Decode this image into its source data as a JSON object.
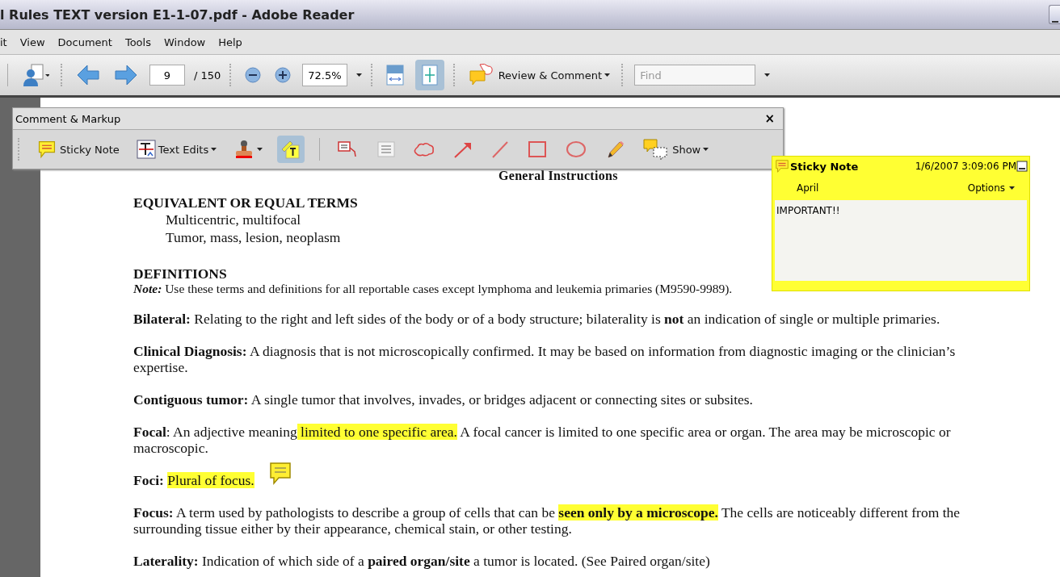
{
  "window": {
    "title": "l Rules TEXT version E1-1-07.pdf - Adobe Reader"
  },
  "menu": [
    "it",
    "View",
    "Document",
    "Tools",
    "Window",
    "Help"
  ],
  "toolbar": {
    "page": "9",
    "page_total": "/ 150",
    "zoom": "72.5%",
    "review_button": "Review & Comment",
    "find_placeholder": "Find",
    "fit_width_selected": false,
    "fit_page_selected": true
  },
  "comment_toolbar": {
    "title": "Comment & Markup",
    "close": "×",
    "tools": [
      {
        "kind": "sticky",
        "label": "Sticky Note",
        "selected": false,
        "dropdown": false
      },
      {
        "kind": "textedits",
        "label": "Text Edits",
        "selected": false,
        "dropdown": true
      },
      {
        "kind": "stamp",
        "selected": false,
        "dropdown": true
      },
      {
        "kind": "highlight",
        "selected": true,
        "dropdown": false
      },
      {
        "kind": "callout",
        "selected": false,
        "dropdown": false
      },
      {
        "kind": "textbox",
        "selected": false,
        "dropdown": false
      },
      {
        "kind": "cloud",
        "selected": false,
        "dropdown": false
      },
      {
        "kind": "arrow",
        "selected": false,
        "dropdown": false
      },
      {
        "kind": "line",
        "selected": false,
        "dropdown": false
      },
      {
        "kind": "rectangle",
        "selected": false,
        "dropdown": false
      },
      {
        "kind": "oval",
        "selected": false,
        "dropdown": false
      },
      {
        "kind": "pencil",
        "selected": false,
        "dropdown": false
      },
      {
        "kind": "show",
        "label": "Show",
        "selected": false,
        "dropdown": true
      }
    ]
  },
  "document": [
    {
      "kind": "title",
      "text": "General Instructions"
    },
    {
      "kind": "heading",
      "text": "EQUIVALENT OR EQUAL TERMS"
    },
    {
      "kind": "indent",
      "text": "Multicentric, multifocal"
    },
    {
      "kind": "indent",
      "text": "Tumor, mass, lesion, neoplasm"
    },
    {
      "kind": "heading",
      "text": "DEFINITIONS"
    },
    {
      "kind": "note",
      "label": "Note:",
      "text": " Use these terms and definitions for all reportable cases except lymphoma and leukemia primaries (M9590-9989)."
    },
    {
      "kind": "definition",
      "term": "Bilateral:",
      "segments": [
        {
          "text": " Relating to the right and left sides of the body or of a body structure; bilaterality is **not** an indication of single or multiple primaries.",
          "highlighted": false
        }
      ]
    },
    {
      "kind": "definition",
      "term": "Clinical Diagnosis:",
      "segments": [
        {
          "text": " A diagnosis that is not microscopically confirmed. It may be based on information from diagnostic imaging or the clinician’s expertise.",
          "highlighted": false
        }
      ]
    },
    {
      "kind": "definition",
      "term": "Contiguous tumor:",
      "segments": [
        {
          "text": "  A single tumor that involves, invades, or bridges adjacent or connecting sites or subsites.",
          "highlighted": false
        }
      ]
    },
    {
      "kind": "definition",
      "term": "Focal",
      "segments": [
        {
          "text": ":  An adjective meaning",
          "highlighted": false
        },
        {
          "text": " limited to one specific area.",
          "highlighted": true
        },
        {
          "text": "  A focal cancer is limited to one specific area or organ.  The area may be microscopic or macroscopic.",
          "highlighted": false
        }
      ]
    },
    {
      "kind": "definition",
      "term": "Foci: ",
      "segments": [
        {
          "text": "Plural of focus.",
          "highlighted": true
        }
      ]
    },
    {
      "kind": "definition",
      "term": "Focus:",
      "segments": [
        {
          "text": "  A term used by pathologists to describe a group of cells that can be ",
          "highlighted": false
        },
        {
          "text": "**seen only by a microscope.**",
          "highlighted": true
        },
        {
          "text": "  The cells are noticeably different from the surrounding tissue either by their appearance, chemical stain, or other testing.",
          "highlighted": false
        }
      ]
    },
    {
      "kind": "definition",
      "term": "Laterality:",
      "segments": [
        {
          "text": "  Indication of which side of a **paired organ/site** a tumor is located. (See Paired organ/site)",
          "highlighted": false
        }
      ]
    }
  ],
  "sticky_note": {
    "title": "Sticky Note",
    "date": "1/6/2007 3:09:06 PM",
    "author": "April",
    "options": "Options",
    "text": "IMPORTANT!!"
  }
}
